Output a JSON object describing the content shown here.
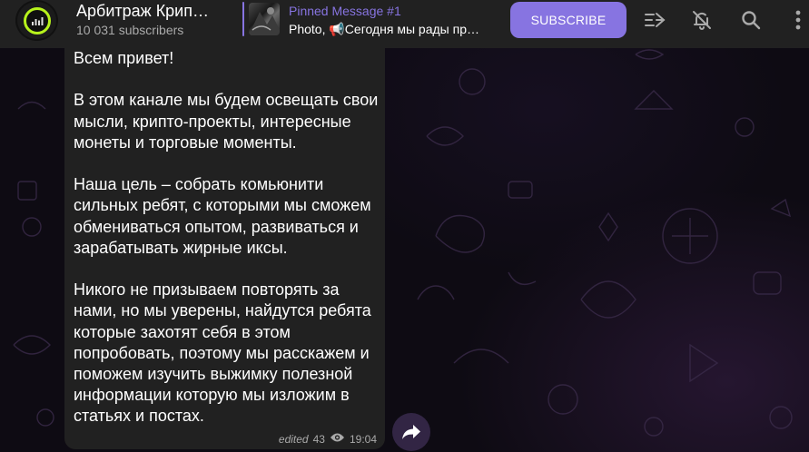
{
  "channel": {
    "title": "Арбитраж Крип…",
    "subscribers": "10 031 subscribers"
  },
  "pinned": {
    "title": "Pinned Message #1",
    "text": "Photo, 📢Сегодня мы рады пр…"
  },
  "header": {
    "subscribe_label": "SUBSCRIBE",
    "icons": [
      "live-stream-icon",
      "mute-bell-icon",
      "search-icon",
      "more-vertical-icon"
    ]
  },
  "message": {
    "text": "Всем привет!\n\nВ этом канале мы будем освещать свои мысли, крипто-проекты, интересные монеты и торговые моменты.\n\nНаша цель – собрать комьюнити сильных ребят, с которыми мы сможем обмениваться опытом, развиваться и зарабатывать жирные иксы.\n\nНикого не призываем повторять за нами, но мы уверены, найдутся ребята которые захотят себя в этом попробовать, поэтому мы расскажем и поможем изучить выжимку полезной информации которую мы изложим в статьях и постах.",
    "edited_label": "edited",
    "views": "43",
    "time": "19:04"
  },
  "colors": {
    "accent": "#8774e1",
    "header_bg": "#212121",
    "bubble_bg": "#212121",
    "avatar_ring": "#b7f21c"
  }
}
